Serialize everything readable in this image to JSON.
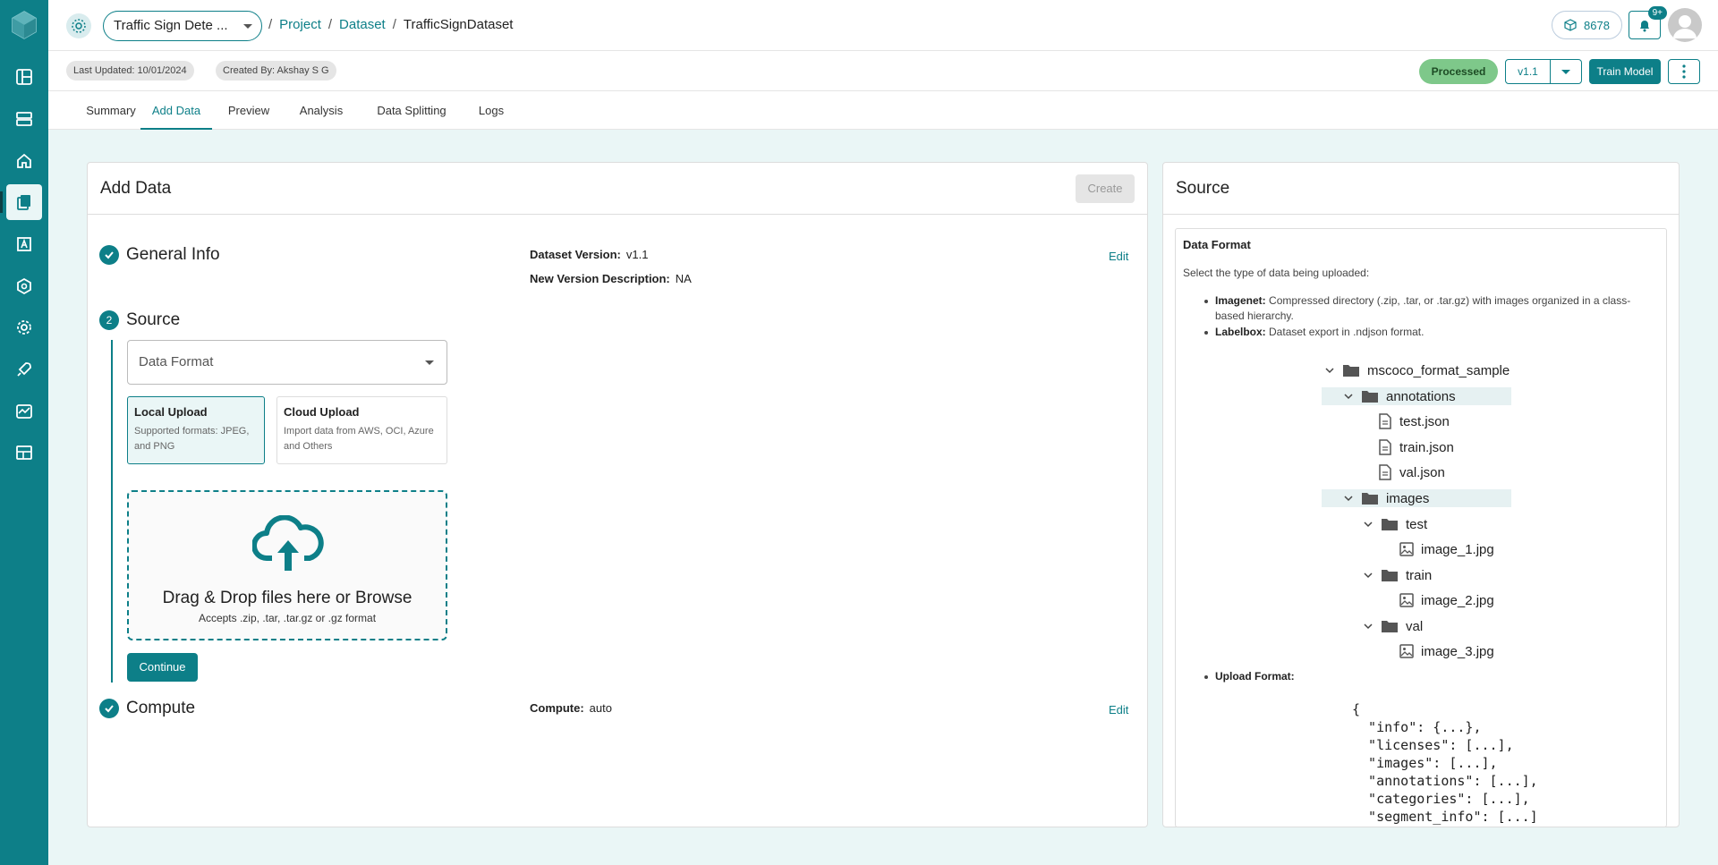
{
  "topbar": {
    "project_name": "Traffic Sign Dete ...",
    "breadcrumbs": [
      "Project",
      "Dataset",
      "TrafficSignDataset"
    ],
    "credits": "8678",
    "notifications_badge": "9+"
  },
  "subbar": {
    "last_updated": "Last Updated: 10/01/2024",
    "created_by": "Created By: Akshay S G",
    "status": "Processed",
    "version": "v1.1",
    "train_label": "Train Model"
  },
  "tabs": [
    "Summary",
    "Add Data",
    "Preview",
    "Analysis",
    "Data Splitting",
    "Logs"
  ],
  "add_data": {
    "title": "Add Data",
    "create_label": "Create",
    "general": {
      "title": "General Info",
      "version_label": "Dataset Version:",
      "version_value": "v1.1",
      "desc_label": "New Version Description:",
      "desc_value": "NA",
      "edit": "Edit"
    },
    "source": {
      "step": "2",
      "title": "Source",
      "select_placeholder": "Data Format",
      "local_title": "Local Upload",
      "local_desc": "Supported formats: JPEG, and PNG",
      "cloud_title": "Cloud Upload",
      "cloud_desc": "Import data from AWS, OCI, Azure and Others",
      "drop_title": "Drag & Drop files here or Browse",
      "drop_sub": "Accepts .zip, .tar, .tar.gz or .gz format",
      "continue": "Continue"
    },
    "compute": {
      "title": "Compute",
      "label": "Compute:",
      "value": "auto",
      "edit": "Edit"
    }
  },
  "source_panel": {
    "title": "Source",
    "data_format_heading": "Data Format",
    "select_text": "Select the type of data being uploaded:",
    "imagenet_label": "Imagenet:",
    "imagenet_desc": "Compressed directory (.zip, .tar, or .tar.gz) with images organized in a class-based hierarchy.",
    "labelbox_label": "Labelbox:",
    "labelbox_desc": "Dataset export in .ndjson format.",
    "tree": {
      "root": "mscoco_format_sample",
      "annotations": "annotations",
      "test_json": "test.json",
      "train_json": "train.json",
      "val_json": "val.json",
      "images": "images",
      "test": "test",
      "image_1": "image_1.jpg",
      "train": "train",
      "image_2": "image_2.jpg",
      "val": "val",
      "image_3": "image_3.jpg"
    },
    "upload_format_label": "Upload Format:",
    "code": "{\n  \"info\": {...},\n  \"licenses\": [...],\n  \"images\": [...],\n  \"annotations\": [...],\n  \"categories\": [...],\n  \"segment_info\": [...]\n}"
  },
  "colors": {
    "brand": "#0d7f88",
    "status": "#7ec88a",
    "background": "#eaf6f6"
  }
}
